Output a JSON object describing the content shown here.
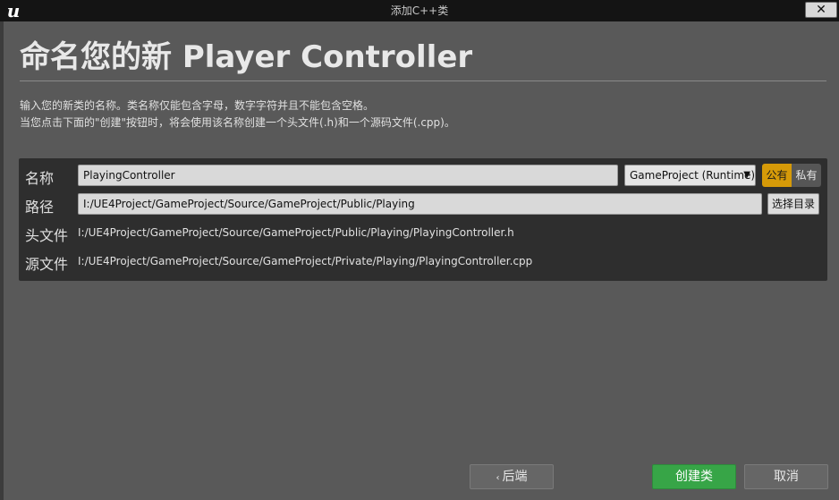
{
  "window": {
    "title": "添加C++类",
    "logo_icon": "unreal-logo-icon",
    "close_label": "✕"
  },
  "heading": {
    "title": "命名您的新 Player Controller"
  },
  "description": {
    "line1": "输入您的新类的名称。类名称仅能包含字母，数字字符并且不能包含空格。",
    "line2": "当您点击下面的\"创建\"按钮时，将会使用该名称创建一个头文件(.h)和一个源码文件(.cpp)。"
  },
  "form": {
    "name_label": "名称",
    "name_value": "PlayingController",
    "module_selected": "GameProject (Runtime)",
    "public_label": "公有",
    "private_label": "私有",
    "path_label": "路径",
    "path_value": "I:/UE4Project/GameProject/Source/GameProject/Public/Playing",
    "choose_dir_label": "选择目录",
    "header_label": "头文件",
    "header_value": "I:/UE4Project/GameProject/Source/GameProject/Public/Playing/PlayingController.h",
    "source_label": "源文件",
    "source_value": "I:/UE4Project/GameProject/Source/GameProject/Private/Playing/PlayingController.cpp"
  },
  "footer": {
    "back_label": "后端",
    "create_label": "创建类",
    "cancel_label": "取消"
  },
  "colors": {
    "accent_public": "#d69a08",
    "create_green": "#37a547",
    "background": "#595959",
    "panel": "#2e2e2e"
  }
}
